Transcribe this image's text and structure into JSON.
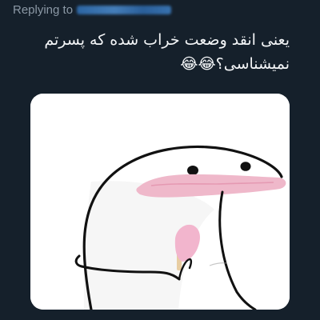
{
  "reply": {
    "prefix": "Replying to"
  },
  "tweet": {
    "line1": "یعنی انقد وضعت خراب شده که پسرتم",
    "line2": "نمیشناسی؟😂😂"
  },
  "media": {
    "alt": "meme-illustration"
  },
  "colors": {
    "background": "#15202b",
    "text": "#f3f5f7",
    "muted": "#8b98a5",
    "link": "#3c7bbd"
  }
}
